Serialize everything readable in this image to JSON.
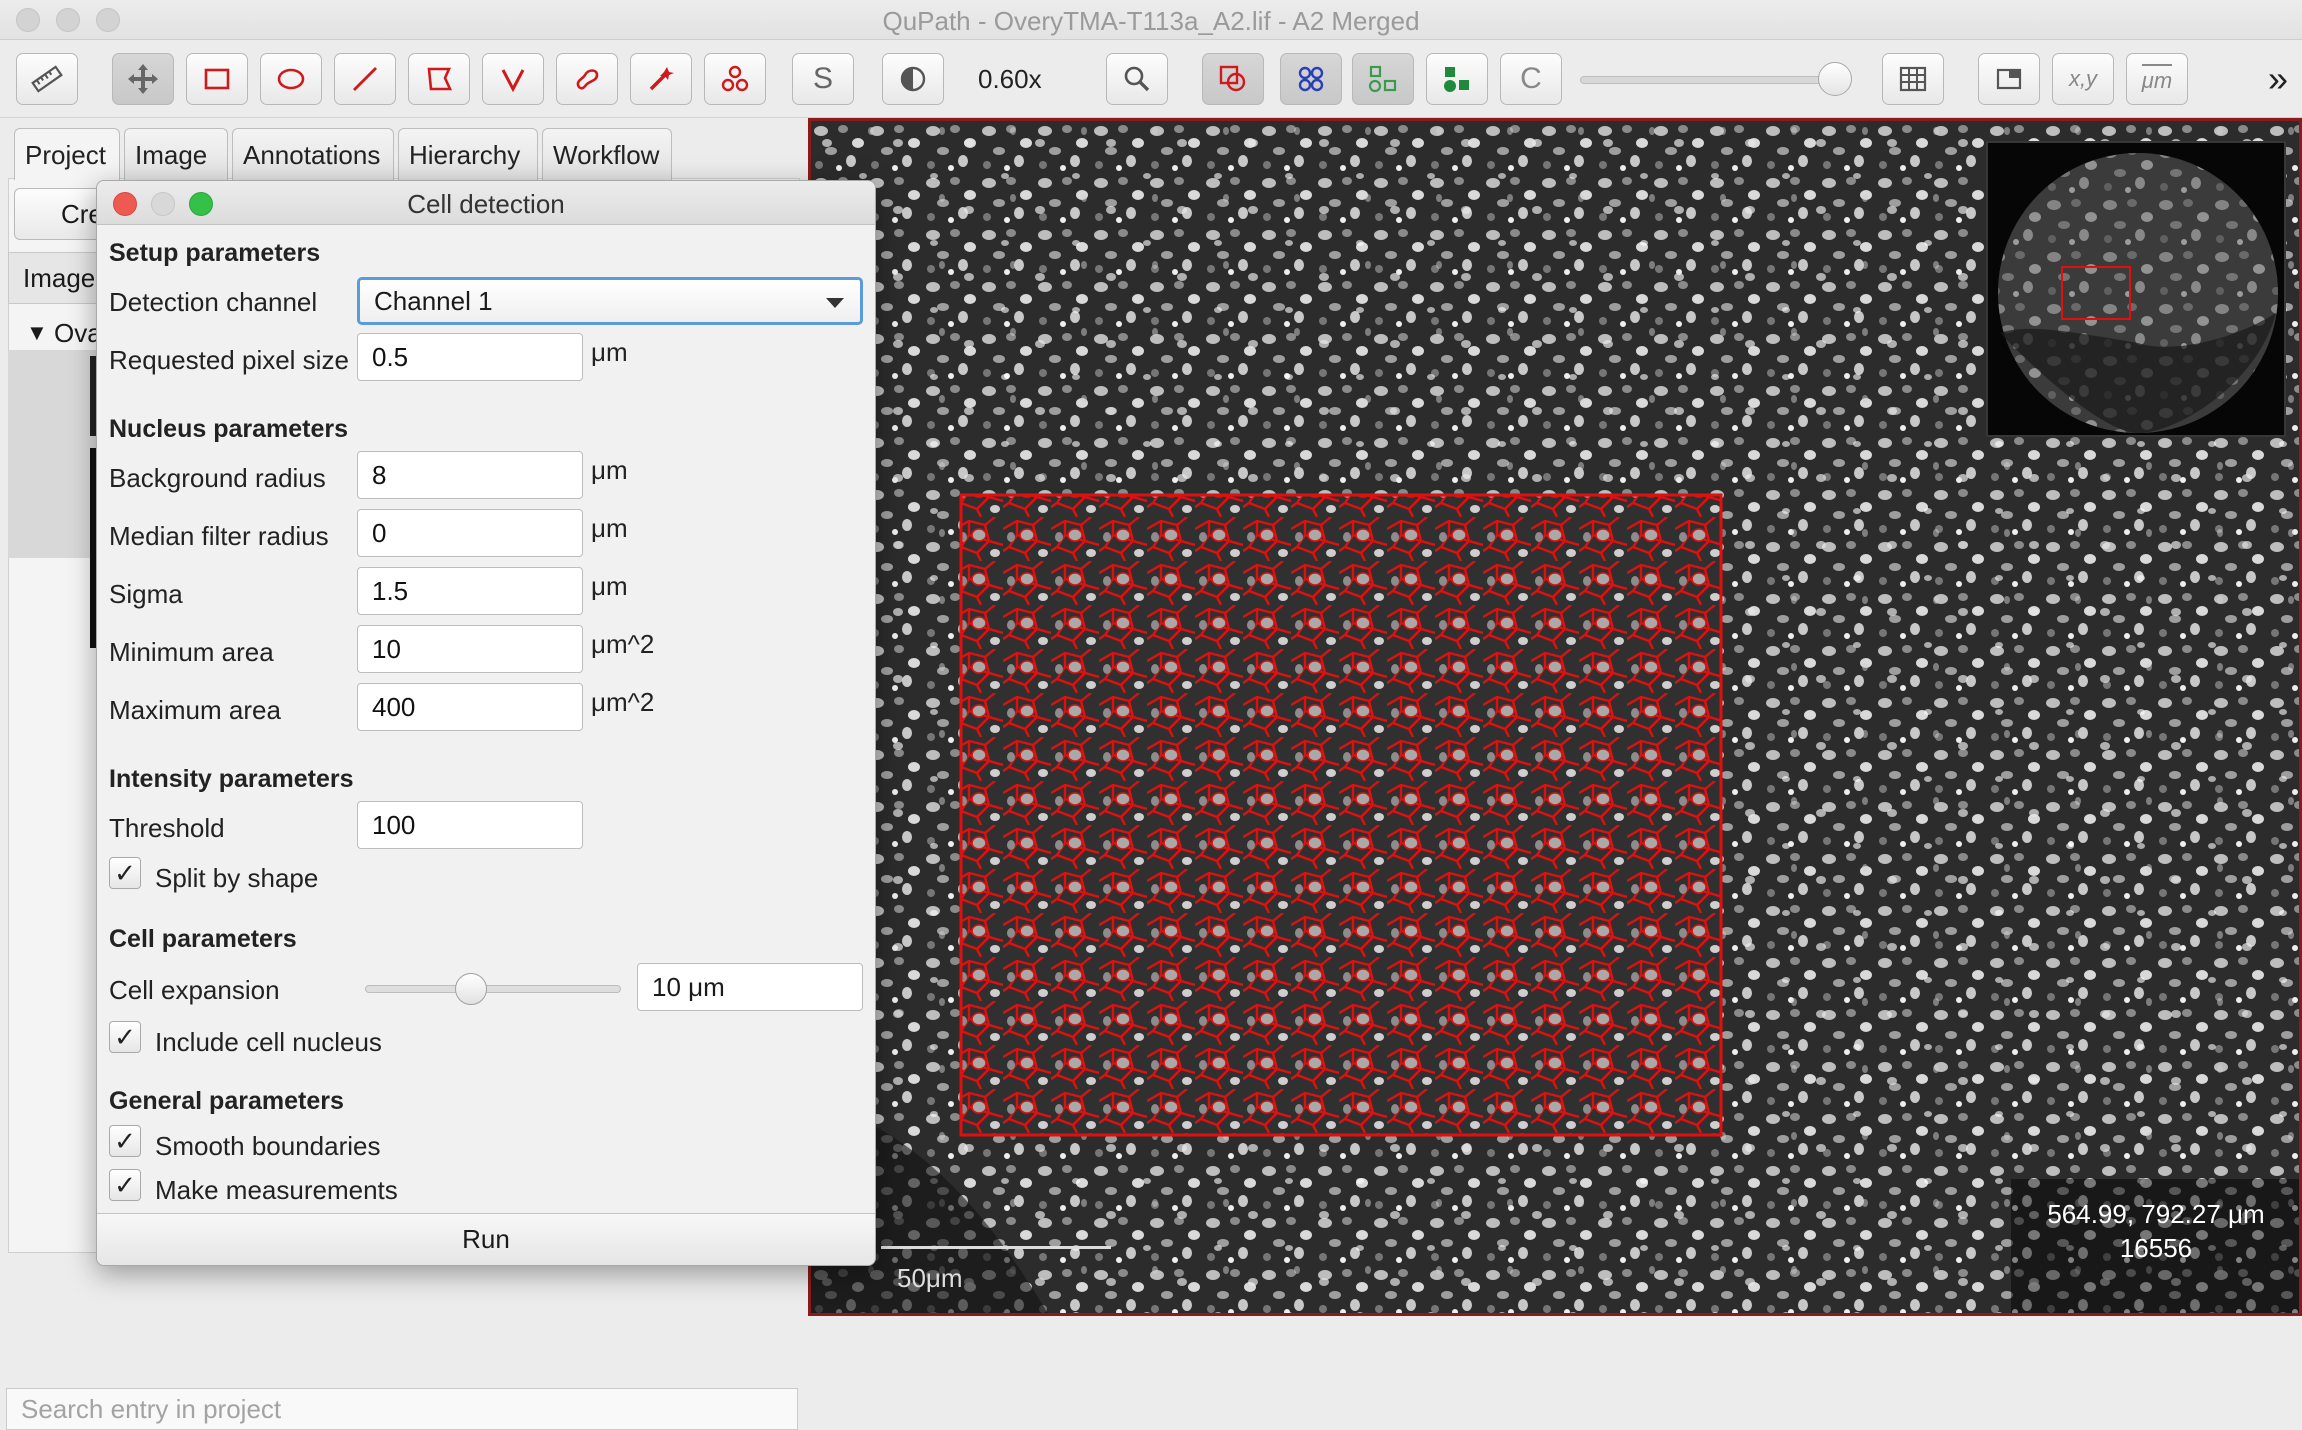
{
  "window": {
    "title": "QuPath - OveryTMA-T113a_A2.lif - A2 Merged"
  },
  "toolbar": {
    "zoom_label": "0.60x",
    "icons": [
      "measure-icon",
      "move-icon",
      "rectangle-icon",
      "ellipse-icon",
      "line-icon",
      "polygon-icon",
      "polyline-icon",
      "brush-icon",
      "wand-icon",
      "points-icon",
      "selection-mode-icon",
      "brightness-contrast-icon",
      "zoom-to-fit-icon",
      "show-annotations-icon",
      "show-tma-grid-icon",
      "show-detections-icon",
      "fill-detections-icon",
      "show-connections-icon",
      "opacity-slider",
      "measurement-table-icon",
      "overview-toggle-icon",
      "location-toggle-icon",
      "scalebar-toggle-icon"
    ],
    "labels": {
      "selection_mode": "S",
      "connections": "C",
      "location": "x,y",
      "scalebar": "μm"
    },
    "overflow": "»",
    "opacity_value": 1.0
  },
  "left_panel": {
    "tabs": [
      {
        "label": "Project"
      },
      {
        "label": "Image"
      },
      {
        "label": "Annotations"
      },
      {
        "label": "Hierarchy"
      },
      {
        "label": "Workflow"
      }
    ],
    "create_button_partial": "Cre",
    "subtab_partial": "Image",
    "tree_item_partial": "Ova",
    "search_placeholder": "Search entry in project"
  },
  "dialog": {
    "title": "Cell detection",
    "setup": {
      "header": "Setup parameters",
      "detection_channel_label": "Detection channel",
      "detection_channel_value": "Channel 1",
      "pixel_size_label": "Requested pixel size",
      "pixel_size_value": "0.5",
      "pixel_size_unit": "μm"
    },
    "nucleus": {
      "header": "Nucleus parameters",
      "background_radius_label": "Background radius",
      "background_radius_value": "8",
      "background_radius_unit": "μm",
      "median_filter_label": "Median filter radius",
      "median_filter_value": "0",
      "median_filter_unit": "μm",
      "sigma_label": "Sigma",
      "sigma_value": "1.5",
      "sigma_unit": "μm",
      "min_area_label": "Minimum area",
      "min_area_value": "10",
      "min_area_unit": "μm^2",
      "max_area_label": "Maximum area",
      "max_area_value": "400",
      "max_area_unit": "μm^2"
    },
    "intensity": {
      "header": "Intensity parameters",
      "threshold_label": "Threshold",
      "threshold_value": "100",
      "split_by_shape_label": "Split by shape",
      "split_by_shape_checked": true
    },
    "cell": {
      "header": "Cell parameters",
      "cell_expansion_label": "Cell expansion",
      "cell_expansion_value": "10 μm",
      "cell_expansion_slider_fraction": 0.4,
      "include_nucleus_label": "Include cell nucleus",
      "include_nucleus_checked": true
    },
    "general": {
      "header": "General parameters",
      "smooth_label": "Smooth boundaries",
      "smooth_checked": true,
      "measurements_label": "Make measurements",
      "measurements_checked": true
    },
    "run_label": "Run",
    "check_glyph": "✓"
  },
  "viewer": {
    "scalebar_label": "50μm",
    "cursor_location": "564.99, 792.27 μm",
    "cursor_value": "16556"
  },
  "colors": {
    "detection_outline": "#e01010",
    "annotation_border": "#e01010",
    "focus_ring": "#5a9bd8",
    "viewer_border": "#8b1a1a"
  }
}
